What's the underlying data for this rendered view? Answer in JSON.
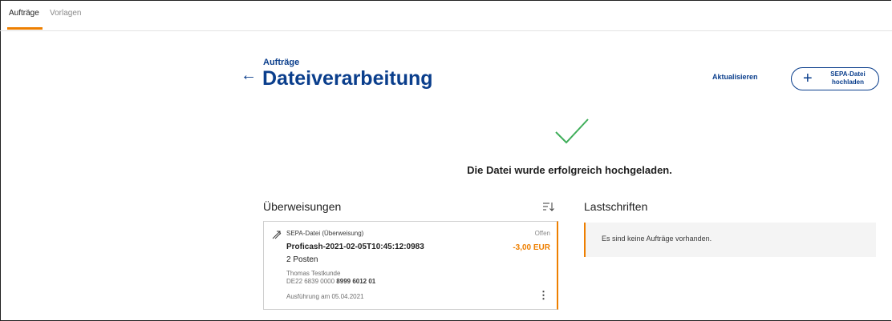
{
  "tabs": [
    {
      "label": "Aufträge",
      "active": true
    },
    {
      "label": "Vorlagen",
      "active": false
    }
  ],
  "header": {
    "breadcrumb": "Aufträge",
    "title": "Dateiverarbeitung",
    "refresh_label": "Aktualisieren",
    "upload_label_line1": "SEPA-Datei",
    "upload_label_line2": "hochladen"
  },
  "success": {
    "icon": "checkmark-icon",
    "message": "Die Datei wurde erfolgreich hochgeladen."
  },
  "transfers": {
    "title": "Überweisungen",
    "sort_icon": "sort-icon",
    "cards": [
      {
        "type_label": "SEPA-Datei (Überweisung)",
        "status": "Offen",
        "filename": "Proficash-2021-02-05T10:45:12:0983",
        "amount": "-3,00 EUR",
        "count": "2 Posten",
        "name": "Thomas Testkunde",
        "iban_prefix": "DE22 6839 0000",
        "iban_suffix": "8999 6012 01",
        "execution": "Ausführung am 05.04.2021"
      }
    ]
  },
  "direct_debits": {
    "title": "Lastschriften",
    "empty_message": "Es sind keine Aufträge vorhanden."
  },
  "colors": {
    "accent": "#ee7f00",
    "brand_blue": "#0a3e8c",
    "success_green": "#3fae5a"
  }
}
